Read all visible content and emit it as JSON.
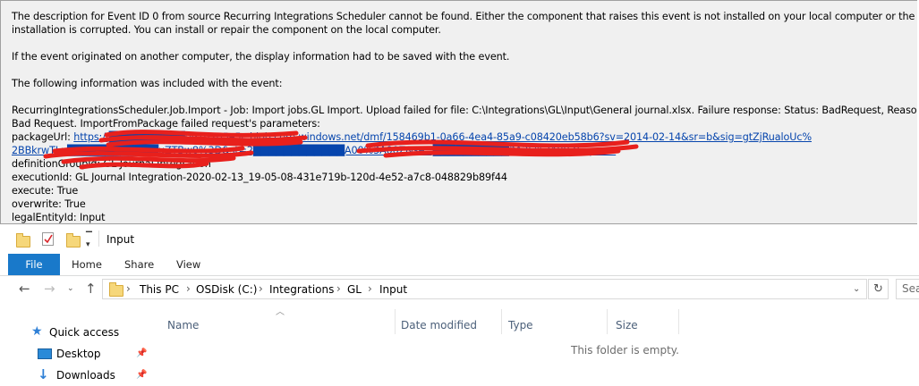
{
  "event": {
    "line1": "The description for Event ID 0 from source Recurring Integrations Scheduler cannot be found. Either the component that raises this event is not installed on your local computer or the",
    "line2": "installation is corrupted. You can install or repair the component on the local computer.",
    "line3": "If the event originated on another computer, the display information had to be saved with the event.",
    "line4": "The following information was included with the event:",
    "line5": "RecurringIntegrationsScheduler.Job.Import - Job: Import jobs.GL Import. Upload failed for file: C:\\Integrations\\GL\\Input\\General journal.xlsx. Failure response:  Status: BadRequest, Reason:",
    "line6": "Bad Request. ImportFromPackage failed request's parameters:",
    "package_label": "packageUrl: ",
    "url_line1": "https://██████████091d205e5c.blob.core.windows.net/dmf/158469b1-0a66-4ea4-85a9-c08420eb58b6?sv=2014-02-14&sr=b&sig=gtZjRualoUc%",
    "url_line2": "2BBkrwTLp████████████uZTBw8%3D&st=2████████████A00%3A00Z&se=██████████3A35%3A08Z&sp=rw",
    "definition": "definitionGroupId: GL Journal Integration",
    "execution": "executionId: GL Journal Integration-2020-02-13_19-05-08-431e719b-120d-4e52-a7c8-048829b89f44",
    "execute": "execute: True",
    "overwrite": "overwrite: True",
    "legal": "legalEntityId: Input"
  },
  "explorer": {
    "title": "Input",
    "tabs": [
      "File",
      "Home",
      "Share",
      "View"
    ],
    "breadcrumb": [
      "This PC",
      "OSDisk (C:)",
      "Integrations",
      "GL",
      "Input"
    ],
    "search_placeholder": "Sea",
    "columns": [
      "Name",
      "Date modified",
      "Type",
      "Size"
    ],
    "empty_message": "This folder is empty.",
    "nav": [
      "Quick access",
      "Desktop",
      "Downloads"
    ]
  },
  "colors": {
    "accent": "#1979ca",
    "link": "#0645ad",
    "redaction": "#e8201c"
  }
}
